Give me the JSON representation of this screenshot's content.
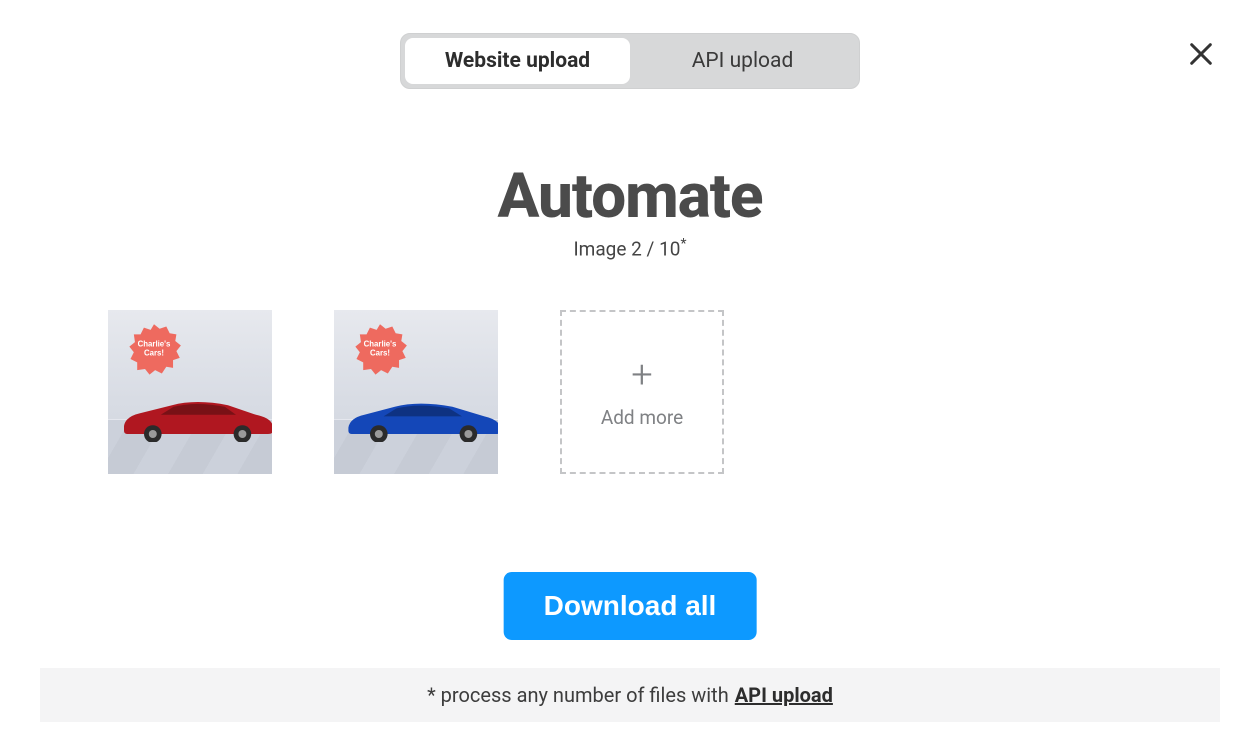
{
  "tabs": {
    "website": "Website upload",
    "api": "API upload",
    "active": "website"
  },
  "title": "Automate",
  "subtitle_prefix": "Image ",
  "subtitle_count": "2 / 10",
  "thumbs": [
    {
      "badge_line1": "Charlie's",
      "badge_line2": "Cars!",
      "car_color": "#b01720"
    },
    {
      "badge_line1": "Charlie's",
      "badge_line2": "Cars!",
      "car_color": "#1447b8"
    }
  ],
  "add_more_label": "Add more",
  "download_button": "Download all",
  "footer_text": "* process any number of files with ",
  "footer_link": "API upload"
}
